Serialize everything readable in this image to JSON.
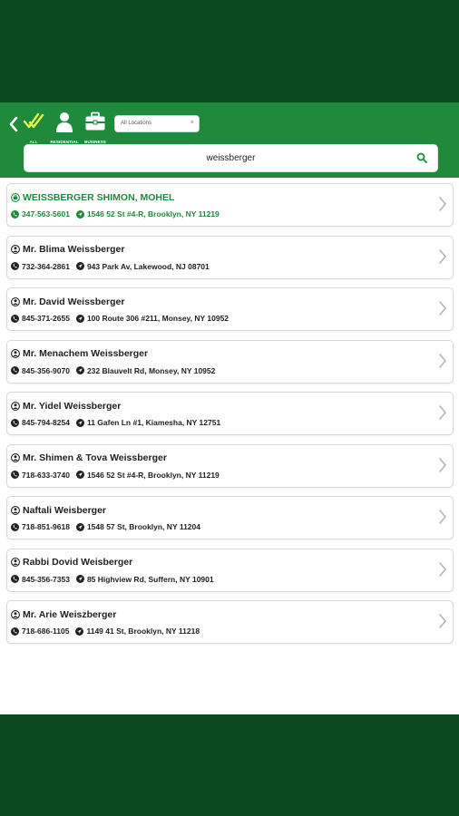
{
  "header": {
    "filters": [
      {
        "label": "ALL",
        "icon": "double-check-icon"
      },
      {
        "label": "RESIDENTIAL",
        "icon": "person-icon"
      },
      {
        "label": "BUSINESS",
        "icon": "briefcase-icon"
      }
    ],
    "location_select": {
      "value": "All Locations"
    },
    "search": {
      "query": "weissberger"
    }
  },
  "results": [
    {
      "name": "WEISSBERGER SHIMON, MOHEL",
      "phone": "347-563-5601",
      "address": "1546 52 St #4-R, Brooklyn, NY 11219",
      "type": "business"
    },
    {
      "name": "Mr. Blima  Weissberger",
      "phone": "732-364-2861",
      "address": "943 Park Av, Lakewood, NJ 08701",
      "type": "residential"
    },
    {
      "name": "Mr. David Weissberger",
      "phone": "845-371-2655",
      "address": "100 Route 306 #211, Monsey, NY 10952",
      "type": "residential"
    },
    {
      "name": "Mr. Menachem Weissberger",
      "phone": "845-356-9070",
      "address": "232 Blauvelt Rd, Monsey, NY 10952",
      "type": "residential"
    },
    {
      "name": "Mr. Yidel Weissberger",
      "phone": "845-794-8254",
      "address": "11 Gafen Ln #1, Kiamesha, NY 12751",
      "type": "residential"
    },
    {
      "name": "Mr. Shimen & Tova Weissberger",
      "phone": "718-633-3740",
      "address": "1546 52 St #4-R, Brooklyn, NY 11219",
      "type": "residential"
    },
    {
      "name": "Naftali Weisberger",
      "phone": "718-851-9618",
      "address": "1548 57 St, Brooklyn, NY 11204",
      "type": "residential"
    },
    {
      "name": "Rabbi Dovid Weisberger",
      "phone": "845-356-7353",
      "address": "85 Highview Rd, Suffern, NY 10901",
      "type": "residential"
    },
    {
      "name": "Mr. Arie Weiszberger",
      "phone": "718-686-1105",
      "address": "1149 41 St, Brooklyn, NY 11218",
      "type": "residential"
    }
  ],
  "colors": {
    "brand_green": "#1f8a3c",
    "frame_green": "#0b4a1f",
    "active_filter": "#e6f24a"
  }
}
